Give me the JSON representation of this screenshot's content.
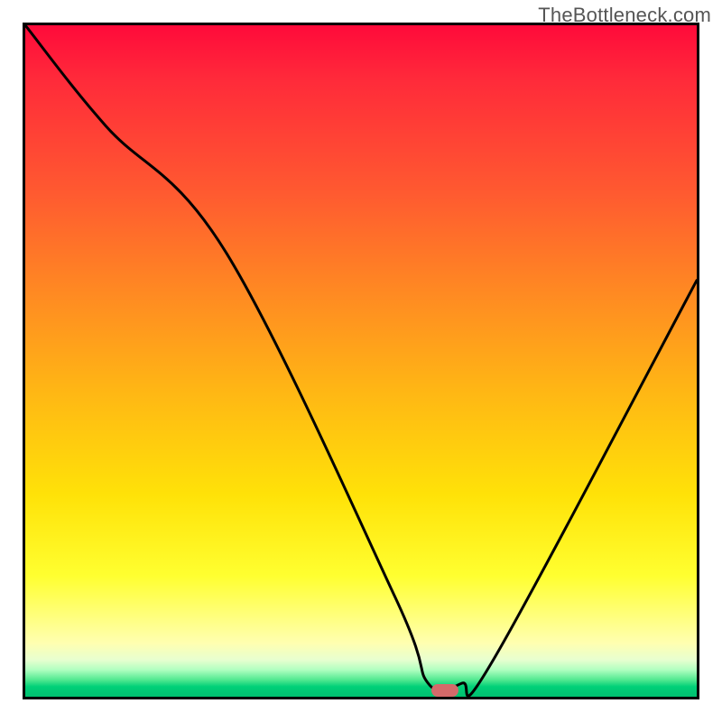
{
  "attribution": "TheBottleneck.com",
  "chart_data": {
    "type": "line",
    "title": "",
    "xlabel": "",
    "ylabel": "",
    "xlim": [
      0,
      100
    ],
    "ylim": [
      0,
      100
    ],
    "x": [
      0,
      12,
      30,
      55,
      60,
      65,
      70,
      100
    ],
    "values": [
      100,
      85,
      66,
      15,
      2,
      2,
      6,
      62
    ],
    "marker": {
      "x": 62.5,
      "y": 1.0,
      "shape": "pill",
      "color": "#d46a6a"
    },
    "background_gradient": {
      "type": "vertical",
      "stops": [
        {
          "pos": 0.0,
          "color": "#ff0a3a"
        },
        {
          "pos": 0.25,
          "color": "#ff5a30"
        },
        {
          "pos": 0.55,
          "color": "#ffb814"
        },
        {
          "pos": 0.82,
          "color": "#ffff30"
        },
        {
          "pos": 0.95,
          "color": "#b0ffc0"
        },
        {
          "pos": 1.0,
          "color": "#00c070"
        }
      ]
    }
  }
}
